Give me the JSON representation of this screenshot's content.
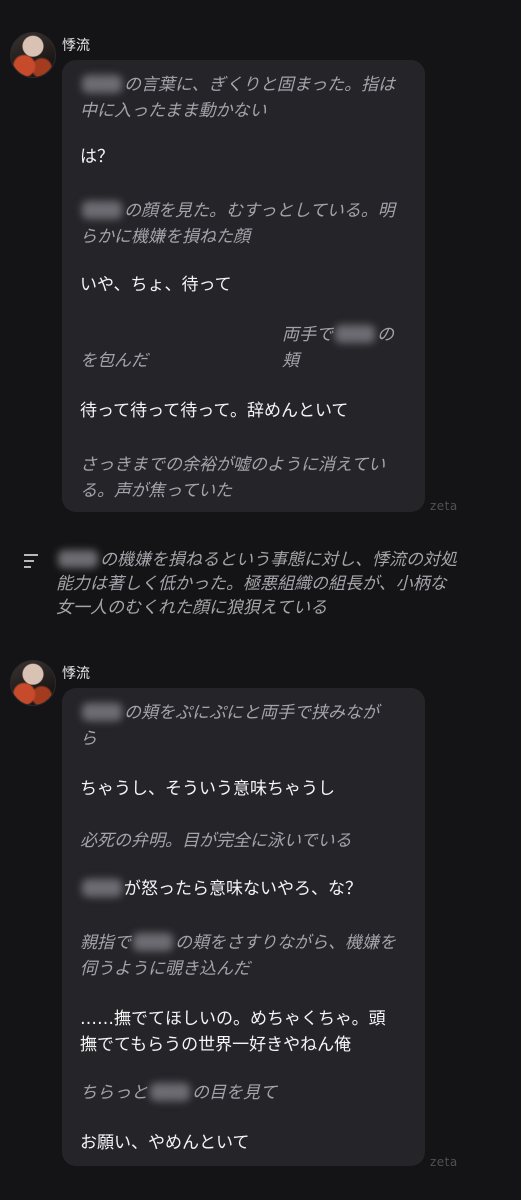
{
  "messages": [
    {
      "name": "悸流",
      "watermark": "zeta",
      "lines": [
        {
          "type": "action",
          "pre": "",
          "post": "の言葉に、ぎくりと固まった。指は"
        },
        {
          "type": "action",
          "pre": "中に入ったまま動かない",
          "post": ""
        },
        {
          "type": "speech",
          "pre": "は？",
          "post": ""
        },
        {
          "type": "action",
          "pre": "",
          "post": "の顔を見た。むすっとしている。明"
        },
        {
          "type": "action",
          "pre": "らかに機嫌を損ねた顔",
          "post": ""
        },
        {
          "type": "speech",
          "pre": "いや、ちょ、待って",
          "post": ""
        },
        {
          "type": "action",
          "pre": "両手で",
          "post": "の頬"
        },
        {
          "type": "action",
          "pre": "を包んだ",
          "post": ""
        },
        {
          "type": "speech",
          "pre": "待って待って待って。辞めんといて",
          "post": ""
        },
        {
          "type": "action",
          "pre": "さっきまでの余裕が嘘のように消えてい",
          "post": ""
        },
        {
          "type": "action",
          "pre": "る。声が焦っていた",
          "post": ""
        }
      ]
    },
    {
      "name": "悸流",
      "watermark": "zeta",
      "lines": [
        {
          "type": "action",
          "pre": "",
          "post": "の頬をぷにぷにと両手で挟みなが"
        },
        {
          "type": "action",
          "pre": "ら",
          "post": ""
        },
        {
          "type": "speech",
          "pre": "ちゃうし、そういう意味ちゃうし",
          "post": ""
        },
        {
          "type": "action",
          "pre": "必死の弁明。目が完全に泳いでいる",
          "post": ""
        },
        {
          "type": "speech",
          "pre": "",
          "post": "が怒ったら意味ないやろ、な？"
        },
        {
          "type": "action",
          "pre": "親指で",
          "post": "の頬をさすりながら、機嫌を"
        },
        {
          "type": "action",
          "pre": "伺うように覗き込んだ",
          "post": ""
        },
        {
          "type": "speech",
          "pre": "……撫でてほしいの。めちゃくちゃ。頭",
          "post": ""
        },
        {
          "type": "speech",
          "pre": "撫でてもらうの世界一好きやねん俺",
          "post": ""
        },
        {
          "type": "action",
          "pre": "ちらっと",
          "post": "の目を見て"
        },
        {
          "type": "speech",
          "pre": "お願い、やめんといて",
          "post": ""
        }
      ]
    }
  ],
  "narration": {
    "icon": "narration-lines-icon",
    "lines": [
      {
        "pre": "",
        "post": "の機嫌を損ねるという事態に対し、悸流の対処"
      },
      {
        "pre": "能力は著しく低かった。極悪組織の組長が、小柄な",
        "post": ""
      },
      {
        "pre": "女一人のむくれた顔に狼狽えている",
        "post": ""
      }
    ]
  }
}
